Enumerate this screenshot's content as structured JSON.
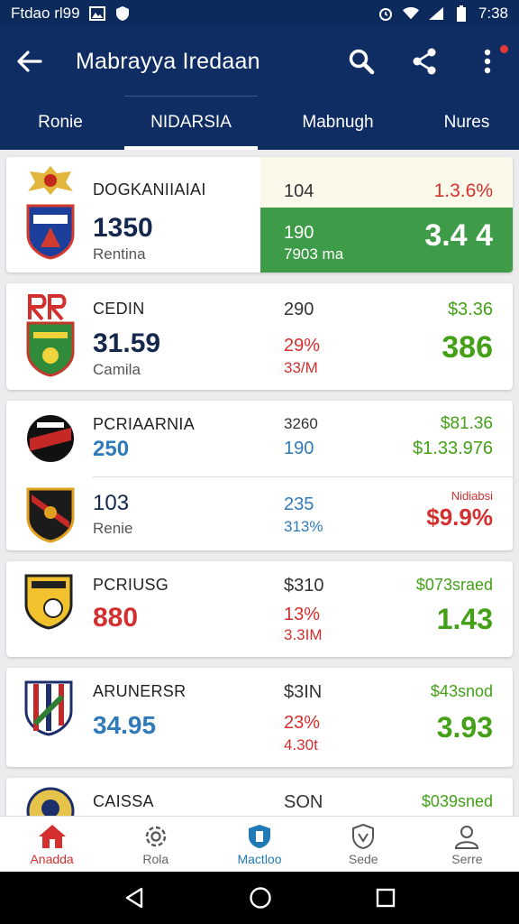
{
  "status_bar": {
    "carrier": "Ftdao rl99",
    "time": "7:38"
  },
  "app_bar": {
    "title": "Mabrayya Iredaan"
  },
  "tabs": [
    {
      "label": "Ronie"
    },
    {
      "label": "NIDARSIA"
    },
    {
      "label": "Mabnugh"
    },
    {
      "label": "Nures"
    }
  ],
  "cards": [
    {
      "name": "DOGKANIIAIAI",
      "value": "1350",
      "sub": "Rentina",
      "mid_top": "104",
      "mid_value": "190",
      "mid_sub": "7903 ma",
      "right_top": "1.3.6%",
      "right_value": "3.4 4"
    },
    {
      "name": "CEDIN",
      "value": "31.59",
      "sub": "Camila",
      "mid_top": "290",
      "mid_value": "29%",
      "mid_sub": "33/M",
      "right_top": "$3.36",
      "right_value": "386"
    },
    {
      "name": "PCRIAARNIA",
      "value": "250",
      "mid_top": "3260",
      "mid_value": "190",
      "right_top": "$81.36",
      "right_value": "$1.33.976"
    },
    {
      "value": "103",
      "sub": "Renie",
      "mid_value": "235",
      "mid_sub": "313%",
      "right_top": "Nidiabsi",
      "right_value": "$9.9%"
    },
    {
      "name": "PCRIUSG",
      "value": "880",
      "mid_top": "$310",
      "mid_value": "13%",
      "mid_sub": "3.3IM",
      "right_top": "$073sraed",
      "right_value": "1.43"
    },
    {
      "name": "ARUNERSR",
      "value": "34.95",
      "mid_top": "$3IN",
      "mid_value": "23%",
      "mid_sub": "4.30t",
      "right_top": "$43snod",
      "right_value": "3.93"
    },
    {
      "name": "CAISSA",
      "mid_top": "SON",
      "right_top": "$039sned"
    }
  ],
  "bottom_nav": [
    {
      "label": "Anadda"
    },
    {
      "label": "Rola"
    },
    {
      "label": "Mactloo"
    },
    {
      "label": "Sede"
    },
    {
      "label": "Serre"
    }
  ],
  "colors": {
    "primary": "#0f2d63",
    "green": "#43a017",
    "red": "#d32f2f",
    "blue": "#2f7ab8"
  },
  "icons": [
    "back-arrow-icon",
    "search-icon",
    "share-icon",
    "more-vert-icon",
    "home-icon",
    "gear-icon",
    "shield-icon",
    "heart-shield-icon",
    "person-icon"
  ]
}
